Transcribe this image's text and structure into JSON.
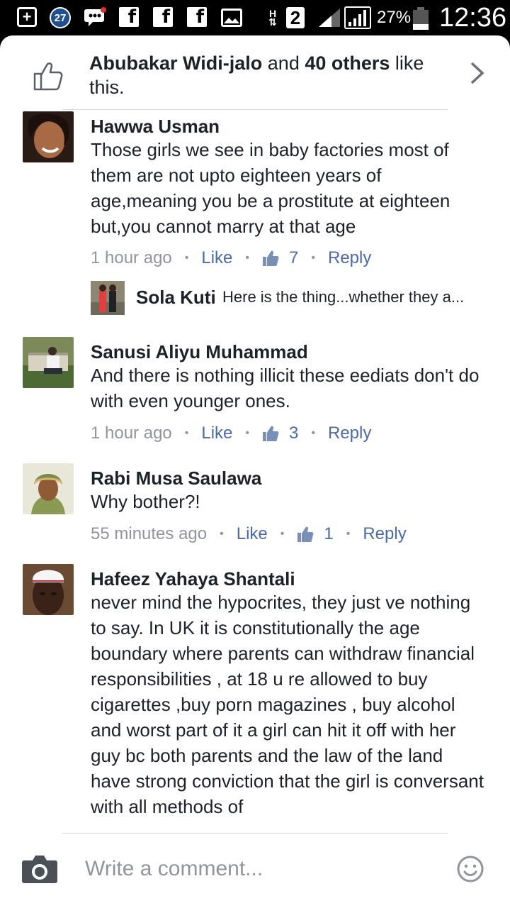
{
  "status_bar": {
    "badge_count": "27",
    "h_indicator": "H",
    "sim_number": "2",
    "battery_percent": "27%",
    "battery_level": 0.27,
    "time": "12:36",
    "icons": [
      "plus-box-icon",
      "notification-badge-icon",
      "bbm-icon",
      "facebook-icon",
      "facebook-icon",
      "facebook-icon",
      "image-icon",
      "h-data-icon",
      "sim2-icon",
      "signal-icon",
      "signal-icon",
      "battery-icon"
    ]
  },
  "likes": {
    "liker": "Abubakar Widi-jalo",
    "and": " and ",
    "others": "40 others",
    "suffix": " like this."
  },
  "comments": [
    {
      "name": "Hawwa Usman",
      "body": "Those girls we see in baby factories most of them are not upto eighteen years of age,meaning you be a prostitute at eighteen but,you cannot marry at that age",
      "time": "1 hour ago",
      "like_label": "Like",
      "like_count": "7",
      "reply_label": "Reply",
      "reply": {
        "name": "Sola Kuti",
        "text": "Here is the thing...whether they a..."
      }
    },
    {
      "name": "Sanusi Aliyu Muhammad",
      "body": "And there is nothing illicit these eediats don't do with even younger ones.",
      "time": "1 hour ago",
      "like_label": "Like",
      "like_count": "3",
      "reply_label": "Reply"
    },
    {
      "name": "Rabi Musa Saulawa",
      "body": "Why bother?!",
      "time": "55 minutes ago",
      "like_label": "Like",
      "like_count": "1",
      "reply_label": "Reply"
    },
    {
      "name": "Hafeez Yahaya Shantali",
      "body": "never mind the hypocrites, they just ve nothing to say. In UK it is constitutionally the age boundary where parents can withdraw financial responsibilities , at 18 u re allowed to buy cigarettes ,buy porn magazines , buy alcohol and worst part of it a girl can hit it off with her guy bc both parents and the law of the land have strong conviction that the girl is conversant with all methods of"
    }
  ],
  "composer": {
    "placeholder": "Write a comment..."
  },
  "colors": {
    "link": "#4b6aa8",
    "meta": "#90949c",
    "text": "#1d2129"
  }
}
